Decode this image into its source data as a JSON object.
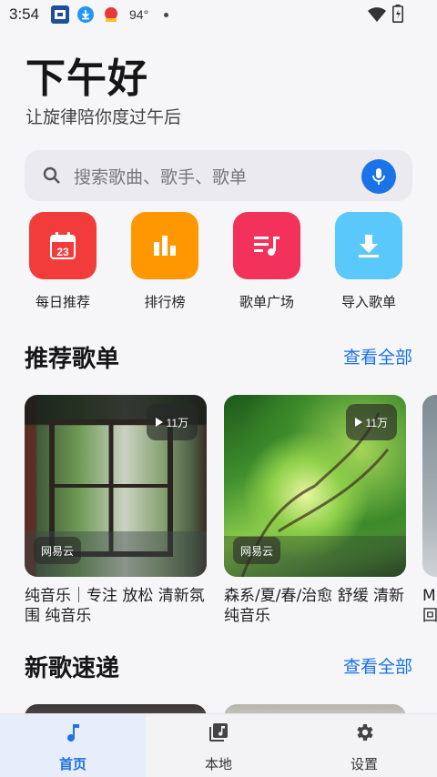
{
  "status_bar": {
    "time": "3:54",
    "temperature": "94°"
  },
  "header": {
    "greeting": "下午好",
    "subtitle": "让旋律陪你度过午后"
  },
  "search": {
    "placeholder": "搜索歌曲、歌手、歌单"
  },
  "quick_actions": [
    {
      "label": "每日推荐",
      "badge": "23",
      "color": "#f23b3b",
      "icon": "calendar-icon"
    },
    {
      "label": "排行榜",
      "color": "#ff9800",
      "icon": "bar-chart-icon"
    },
    {
      "label": "歌单广场",
      "color": "#f2325a",
      "icon": "playlist-icon"
    },
    {
      "label": "导入歌单",
      "color": "#5ac8fa",
      "icon": "download-icon"
    }
  ],
  "recommended": {
    "title": "推荐歌单",
    "see_all": "查看全部",
    "playlists": [
      {
        "plays": "11万",
        "source": "网易云",
        "title": "纯音乐｜专注 放松 清新氛围 纯音乐"
      },
      {
        "plays": "11万",
        "source": "网易云",
        "title": "森系/夏/春/治愈 舒缓 清新 纯音乐"
      },
      {
        "title": "M 回"
      }
    ]
  },
  "new_songs": {
    "title": "新歌速递",
    "see_all": "查看全部"
  },
  "bottom_nav": [
    {
      "label": "首页",
      "icon": "music-note-icon",
      "active": true
    },
    {
      "label": "本地",
      "icon": "local-library-icon",
      "active": false
    },
    {
      "label": "设置",
      "icon": "gear-icon",
      "active": false
    }
  ],
  "colors": {
    "accent": "#1a73e8",
    "background": "#f6f6f9"
  }
}
